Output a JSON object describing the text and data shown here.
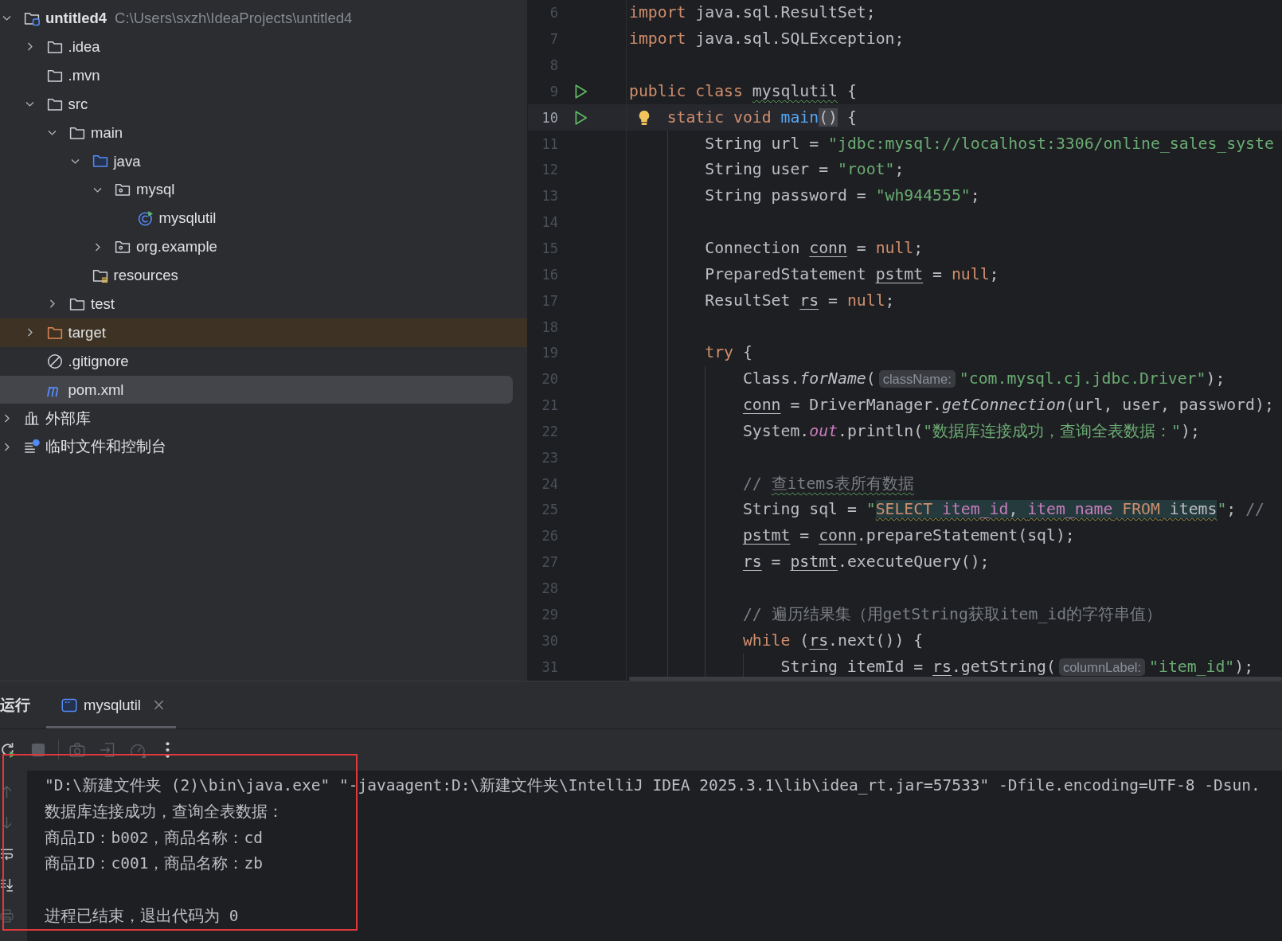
{
  "project_tree": {
    "items": [
      {
        "label": "untitled4",
        "path": "C:\\Users\\sxzh\\IdeaProjects\\untitled4",
        "kind": "project",
        "expanded": true,
        "selected": false,
        "children": [
          {
            "label": ".idea",
            "kind": "folder",
            "expanded": false,
            "selected": false
          },
          {
            "label": ".mvn",
            "kind": "folder",
            "selected": false
          },
          {
            "label": "src",
            "kind": "folder",
            "expanded": true,
            "selected": false,
            "children": [
              {
                "label": "main",
                "kind": "folder",
                "expanded": true,
                "selected": false,
                "children": [
                  {
                    "label": "java",
                    "kind": "source_root",
                    "expanded": true,
                    "selected": false,
                    "children": [
                      {
                        "label": "mysql",
                        "kind": "package",
                        "expanded": true,
                        "selected": false,
                        "children": [
                          {
                            "label": "mysqlutil",
                            "kind": "class",
                            "selected": false
                          }
                        ]
                      },
                      {
                        "label": "org.example",
                        "kind": "package",
                        "expanded": false,
                        "selected": false
                      }
                    ]
                  },
                  {
                    "label": "resources",
                    "kind": "resources_root",
                    "selected": false
                  }
                ]
              },
              {
                "label": "test",
                "kind": "folder",
                "expanded": false,
                "selected": false
              }
            ]
          },
          {
            "label": "target",
            "kind": "excluded_folder",
            "expanded": false,
            "selected": false
          },
          {
            "label": ".gitignore",
            "kind": "ignore_file",
            "selected": false
          },
          {
            "label": "pom.xml",
            "kind": "maven_file",
            "selected": true
          }
        ]
      },
      {
        "label": "外部库",
        "kind": "libraries",
        "expanded": false,
        "selected": false
      },
      {
        "label": "临时文件和控制台",
        "kind": "scratches",
        "expanded": false,
        "selected": false
      }
    ]
  },
  "editor": {
    "lines": [
      {
        "number": "6",
        "current": false,
        "run_marker": false,
        "bulb": false,
        "tokens": [
          {
            "kind": "keyword",
            "text": "import"
          },
          {
            "kind": "plain",
            "text": " java.sql.ResultSet;"
          }
        ]
      },
      {
        "number": "7",
        "current": false,
        "run_marker": false,
        "bulb": false,
        "tokens": [
          {
            "kind": "keyword",
            "text": "import"
          },
          {
            "kind": "plain",
            "text": " java.sql.SQLException;"
          }
        ]
      },
      {
        "number": "8",
        "current": false,
        "run_marker": false,
        "bulb": false
      },
      {
        "number": "9",
        "current": false,
        "run_marker": true,
        "bulb": false,
        "tokens": [
          {
            "kind": "keyword",
            "text": "public class "
          },
          {
            "kind": "typo",
            "text": "mysqlutil"
          },
          {
            "kind": "plain",
            "text": " {"
          }
        ],
        "children": [
          {
            "number": "10",
            "current": true,
            "run_marker": true,
            "bulb": true,
            "tokens": [
              {
                "kind": "keyword",
                "text": "static void "
              },
              {
                "kind": "declaration",
                "text": "main"
              },
              {
                "kind": "brace_match",
                "text": "()"
              },
              {
                "kind": "plain",
                "text": " {"
              }
            ],
            "children": [
              {
                "number": "11",
                "current": false,
                "run_marker": false,
                "bulb": false,
                "tokens": [
                  {
                    "kind": "plain",
                    "text": "String url = "
                  },
                  {
                    "kind": "string",
                    "text": "\"jdbc:mysql://localhost:3306/online_sales_syste"
                  }
                ]
              },
              {
                "number": "12",
                "current": false,
                "run_marker": false,
                "bulb": false,
                "tokens": [
                  {
                    "kind": "plain",
                    "text": "String user = "
                  },
                  {
                    "kind": "string",
                    "text": "\"root\""
                  },
                  {
                    "kind": "plain",
                    "text": ";"
                  }
                ]
              },
              {
                "number": "13",
                "current": false,
                "run_marker": false,
                "bulb": false,
                "tokens": [
                  {
                    "kind": "plain",
                    "text": "String password = "
                  },
                  {
                    "kind": "string",
                    "text": "\"wh944555\""
                  },
                  {
                    "kind": "plain",
                    "text": ";"
                  }
                ]
              },
              {
                "number": "14",
                "current": false,
                "run_marker": false,
                "bulb": false
              },
              {
                "number": "15",
                "current": false,
                "run_marker": false,
                "bulb": false,
                "tokens": [
                  {
                    "kind": "plain",
                    "text": "Connection "
                  },
                  {
                    "kind": "variable",
                    "text": "conn"
                  },
                  {
                    "kind": "plain",
                    "text": " = "
                  },
                  {
                    "kind": "keyword",
                    "text": "null"
                  },
                  {
                    "kind": "plain",
                    "text": ";"
                  }
                ]
              },
              {
                "number": "16",
                "current": false,
                "run_marker": false,
                "bulb": false,
                "tokens": [
                  {
                    "kind": "plain",
                    "text": "PreparedStatement "
                  },
                  {
                    "kind": "variable",
                    "text": "pstmt"
                  },
                  {
                    "kind": "plain",
                    "text": " = "
                  },
                  {
                    "kind": "keyword",
                    "text": "null"
                  },
                  {
                    "kind": "plain",
                    "text": ";"
                  }
                ]
              },
              {
                "number": "17",
                "current": false,
                "run_marker": false,
                "bulb": false,
                "tokens": [
                  {
                    "kind": "plain",
                    "text": "ResultSet "
                  },
                  {
                    "kind": "variable",
                    "text": "rs"
                  },
                  {
                    "kind": "plain",
                    "text": " = "
                  },
                  {
                    "kind": "keyword",
                    "text": "null"
                  },
                  {
                    "kind": "plain",
                    "text": ";"
                  }
                ]
              },
              {
                "number": "18",
                "current": false,
                "run_marker": false,
                "bulb": false
              },
              {
                "number": "19",
                "current": false,
                "run_marker": false,
                "bulb": false,
                "tokens": [
                  {
                    "kind": "keyword",
                    "text": "try"
                  },
                  {
                    "kind": "plain",
                    "text": " {"
                  }
                ],
                "children": [
                  {
                    "number": "20",
                    "current": false,
                    "run_marker": false,
                    "bulb": false,
                    "tokens": [
                      {
                        "kind": "plain",
                        "text": "Class."
                      },
                      {
                        "kind": "static_call",
                        "text": "forName"
                      },
                      {
                        "kind": "plain",
                        "text": "("
                      },
                      {
                        "kind": "hint",
                        "text": "className:"
                      },
                      {
                        "kind": "string",
                        "text": "\"com.mysql.cj.jdbc.Driver\""
                      },
                      {
                        "kind": "plain",
                        "text": ");"
                      }
                    ]
                  },
                  {
                    "number": "21",
                    "current": false,
                    "run_marker": false,
                    "bulb": false,
                    "tokens": [
                      {
                        "kind": "variable",
                        "text": "conn"
                      },
                      {
                        "kind": "plain",
                        "text": " = DriverManager."
                      },
                      {
                        "kind": "static_call",
                        "text": "getConnection"
                      },
                      {
                        "kind": "plain",
                        "text": "(url, user, password);"
                      }
                    ]
                  },
                  {
                    "number": "22",
                    "current": false,
                    "run_marker": false,
                    "bulb": false,
                    "tokens": [
                      {
                        "kind": "plain",
                        "text": "System."
                      },
                      {
                        "kind": "static_field",
                        "text": "out"
                      },
                      {
                        "kind": "plain",
                        "text": ".println("
                      },
                      {
                        "kind": "string",
                        "text": "\"数据库连接成功，查询全表数据：\""
                      },
                      {
                        "kind": "plain",
                        "text": ");"
                      }
                    ]
                  },
                  {
                    "number": "23",
                    "current": false,
                    "run_marker": false,
                    "bulb": false
                  },
                  {
                    "number": "24",
                    "current": false,
                    "run_marker": false,
                    "bulb": false,
                    "tokens": [
                      {
                        "kind": "comment",
                        "text": "// "
                      },
                      {
                        "kind": "comment_typo",
                        "text": "查items表所有数据"
                      }
                    ]
                  },
                  {
                    "number": "25",
                    "current": false,
                    "run_marker": false,
                    "bulb": false,
                    "tokens": [
                      {
                        "kind": "plain",
                        "text": "String sql = "
                      },
                      {
                        "kind": "string",
                        "text": "\""
                      },
                      {
                        "kind": "sql_keyword",
                        "text": "SELECT "
                      },
                      {
                        "kind": "sql_column",
                        "text": "item_id"
                      },
                      {
                        "kind": "sql_plain",
                        "text": ", "
                      },
                      {
                        "kind": "sql_column",
                        "text": "item_name"
                      },
                      {
                        "kind": "sql_keyword",
                        "text": " FROM"
                      },
                      {
                        "kind": "sql_plain",
                        "text": " items"
                      },
                      {
                        "kind": "string",
                        "text": "\""
                      },
                      {
                        "kind": "plain",
                        "text": "; "
                      },
                      {
                        "kind": "comment",
                        "text": "//"
                      }
                    ]
                  },
                  {
                    "number": "26",
                    "current": false,
                    "run_marker": false,
                    "bulb": false,
                    "tokens": [
                      {
                        "kind": "variable",
                        "text": "pstmt"
                      },
                      {
                        "kind": "plain",
                        "text": " = "
                      },
                      {
                        "kind": "variable",
                        "text": "conn"
                      },
                      {
                        "kind": "plain",
                        "text": ".prepareStatement(sql);"
                      }
                    ]
                  },
                  {
                    "number": "27",
                    "current": false,
                    "run_marker": false,
                    "bulb": false,
                    "tokens": [
                      {
                        "kind": "variable",
                        "text": "rs"
                      },
                      {
                        "kind": "plain",
                        "text": " = "
                      },
                      {
                        "kind": "variable",
                        "text": "pstmt"
                      },
                      {
                        "kind": "plain",
                        "text": ".executeQuery();"
                      }
                    ]
                  },
                  {
                    "number": "28",
                    "current": false,
                    "run_marker": false,
                    "bulb": false
                  },
                  {
                    "number": "29",
                    "current": false,
                    "run_marker": false,
                    "bulb": false,
                    "tokens": [
                      {
                        "kind": "comment",
                        "text": "// 遍历结果集（用getString获取item_id的字符串值）"
                      }
                    ]
                  },
                  {
                    "number": "30",
                    "current": false,
                    "run_marker": false,
                    "bulb": false,
                    "tokens": [
                      {
                        "kind": "keyword",
                        "text": "while"
                      },
                      {
                        "kind": "plain",
                        "text": " ("
                      },
                      {
                        "kind": "variable",
                        "text": "rs"
                      },
                      {
                        "kind": "plain",
                        "text": ".next()) {"
                      }
                    ],
                    "children": [
                      {
                        "number": "31",
                        "current": false,
                        "run_marker": false,
                        "bulb": false,
                        "tokens": [
                          {
                            "kind": "plain",
                            "text": "String itemId = "
                          },
                          {
                            "kind": "variable",
                            "text": "rs"
                          },
                          {
                            "kind": "plain",
                            "text": ".getString("
                          },
                          {
                            "kind": "hint",
                            "text": "columnLabel:"
                          },
                          {
                            "kind": "string",
                            "text": "\"item_id\""
                          },
                          {
                            "kind": "plain",
                            "text": ");"
                          }
                        ]
                      }
                    ]
                  }
                ]
              }
            ]
          }
        ]
      }
    ]
  },
  "run_panel": {
    "title": "运行",
    "tabs": [
      {
        "label": "mysqlutil",
        "selected": true
      }
    ],
    "toolbar": [
      {
        "kind": "rerun",
        "disabled": false
      },
      {
        "kind": "stop",
        "disabled": true
      },
      {
        "kind": "separator"
      },
      {
        "kind": "screenshot",
        "disabled": true
      },
      {
        "kind": "exit",
        "disabled": true
      },
      {
        "kind": "profiler",
        "disabled": true
      },
      {
        "kind": "more",
        "disabled": false
      }
    ],
    "side_toolbar": [
      {
        "kind": "scroll_up",
        "disabled": true
      },
      {
        "kind": "scroll_down",
        "disabled": true
      },
      {
        "kind": "soft_wrap",
        "disabled": false
      },
      {
        "kind": "scroll_to_end",
        "disabled": false
      },
      {
        "kind": "print",
        "disabled": true
      }
    ],
    "console": {
      "lines": [
        "\"D:\\新建文件夹 (2)\\bin\\java.exe\" \"-javaagent:D:\\新建文件夹\\IntelliJ IDEA 2025.3.1\\lib\\idea_rt.jar=57533\" -Dfile.encoding=UTF-8 -Dsun.",
        "数据库连接成功，查询全表数据：",
        "商品ID：b002，商品名称：cd",
        "商品ID：c001，商品名称：zb"
      ],
      "exit_message": "进程已结束，退出代码为 0"
    }
  },
  "annotation": {
    "kind": "rectangle"
  }
}
